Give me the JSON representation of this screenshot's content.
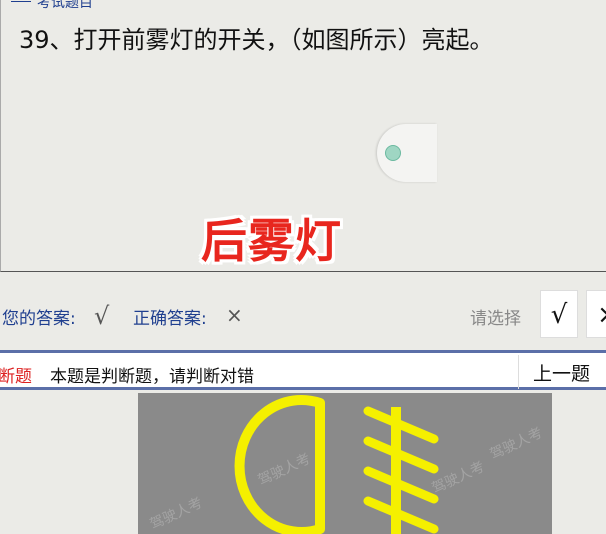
{
  "header": {
    "section_label": "考试题目"
  },
  "question": {
    "text": "39、打开前雾灯的开关，（如图所示）亮起。"
  },
  "stamp": {
    "text": "后雾灯",
    "color": "#e8261e"
  },
  "answer_row": {
    "your_answer_label": "您的答案:",
    "your_answer_mark": "√",
    "correct_answer_label": "正确答案:",
    "correct_answer_mark": "×",
    "choose_label": "请选择",
    "option_true": "√",
    "option_false": "×"
  },
  "type_bar": {
    "type_tag": "断题",
    "description": "本题是判断题，请判断对错",
    "prev_button": "上一题"
  },
  "image": {
    "icon": "rear-fog-lamp-icon",
    "symbol_color": "#f5f000",
    "watermark": "驾驶人考"
  }
}
